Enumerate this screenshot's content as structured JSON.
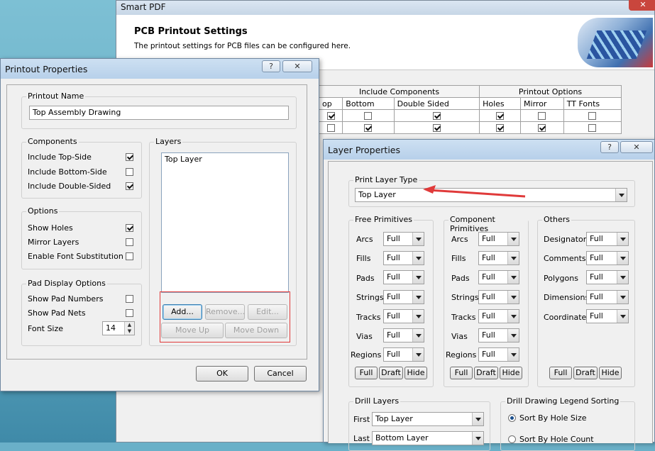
{
  "smart_pdf": {
    "title": "Smart PDF",
    "heading": "PCB Printout Settings",
    "subheading": "The printout settings for PCB files can be configured here.",
    "table": {
      "group_headers": [
        "Include Components",
        "Printout Options"
      ],
      "columns": [
        "op",
        "Bottom",
        "Double Sided",
        "Holes",
        "Mirror",
        "TT Fonts"
      ],
      "rows": [
        [
          true,
          false,
          true,
          true,
          false,
          false
        ],
        [
          false,
          true,
          true,
          true,
          true,
          false
        ]
      ]
    }
  },
  "printout": {
    "title": "Printout Properties",
    "help": "?",
    "close": "✕",
    "name_label": "Printout Name",
    "name_value": "Top Assembly Drawing",
    "components_label": "Components",
    "components": [
      {
        "label": "Include Top-Side",
        "checked": true
      },
      {
        "label": "Include Bottom-Side",
        "checked": false
      },
      {
        "label": "Include Double-Sided",
        "checked": true
      }
    ],
    "options_label": "Options",
    "options": [
      {
        "label": "Show Holes",
        "checked": true
      },
      {
        "label": "Mirror Layers",
        "checked": false
      },
      {
        "label": "Enable Font Substitution",
        "checked": false
      }
    ],
    "pad_label": "Pad Display Options",
    "pad": [
      {
        "label": "Show Pad Numbers",
        "checked": false
      },
      {
        "label": "Show Pad Nets",
        "checked": false
      }
    ],
    "font_size_label": "Font Size",
    "font_size_value": "14",
    "layers_label": "Layers",
    "layers": [
      "Top Layer"
    ],
    "add": "Add...",
    "remove": "Remove...",
    "edit": "Edit...",
    "move_up": "Move Up",
    "move_down": "Move Down",
    "ok": "OK",
    "cancel": "Cancel"
  },
  "layer": {
    "title": "Layer Properties",
    "help": "?",
    "close": "✕",
    "print_type_label": "Print Layer Type",
    "print_type_value": "Top Layer",
    "free_label": "Free Primitives",
    "free": [
      {
        "label": "Arcs",
        "value": "Full"
      },
      {
        "label": "Fills",
        "value": "Full"
      },
      {
        "label": "Pads",
        "value": "Full"
      },
      {
        "label": "Strings",
        "value": "Full"
      },
      {
        "label": "Tracks",
        "value": "Full"
      },
      {
        "label": "Vias",
        "value": "Full"
      },
      {
        "label": "Regions",
        "value": "Full"
      }
    ],
    "comp_label": "Component Primitives",
    "comp": [
      {
        "label": "Arcs",
        "value": "Full"
      },
      {
        "label": "Fills",
        "value": "Full"
      },
      {
        "label": "Pads",
        "value": "Full"
      },
      {
        "label": "Strings",
        "value": "Full"
      },
      {
        "label": "Tracks",
        "value": "Full"
      },
      {
        "label": "Vias",
        "value": "Full"
      },
      {
        "label": "Regions",
        "value": "Full"
      }
    ],
    "others_label": "Others",
    "others": [
      {
        "label": "Designators",
        "value": "Full"
      },
      {
        "label": "Comments",
        "value": "Full"
      },
      {
        "label": "Polygons",
        "value": "Full"
      },
      {
        "label": "Dimensions",
        "value": "Full"
      },
      {
        "label": "Coordinates",
        "value": "Full"
      }
    ],
    "full": "Full",
    "draft": "Draft",
    "hide": "Hide",
    "drill_label": "Drill Layers",
    "first_label": "First",
    "first_value": "Top Layer",
    "last_label": "Last",
    "last_value": "Bottom Layer",
    "legend_label": "Drill Drawing Legend Sorting",
    "sort_size": "Sort By Hole Size",
    "sort_count": "Sort By Hole Count"
  },
  "colors": {
    "annotation_red": "#e03a3a",
    "title_bar": "#b7d0ea"
  }
}
